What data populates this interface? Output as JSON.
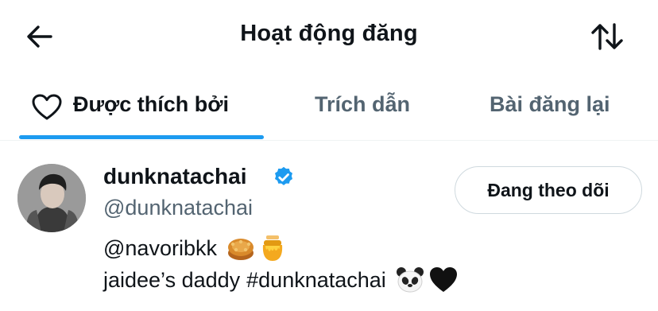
{
  "header": {
    "title": "Hoạt động đăng",
    "back_icon": "arrow-left-icon",
    "sort_icon": "sort-arrows-icon"
  },
  "tabs": [
    {
      "label": "Được thích bởi",
      "icon": "heart-outline-icon",
      "active": true
    },
    {
      "label": "Trích dẫn",
      "active": false
    },
    {
      "label": "Bài đăng lại",
      "active": false
    }
  ],
  "user": {
    "display_name": "dunknatachai",
    "verified": true,
    "handle": "@dunknatachai",
    "follow_button": "Đang theo dõi",
    "bio_line1": {
      "mention": "@navoribkk",
      "emojis": [
        "mooncake-emoji",
        "honey-pot-emoji"
      ]
    },
    "bio_line2": {
      "text": "jaidee’s daddy",
      "hashtag": "#dunknatachai",
      "emojis": [
        "panda-emoji",
        "black-heart-emoji"
      ]
    }
  },
  "colors": {
    "accent": "#1d9bf0",
    "text_primary": "#0f1419",
    "text_secondary": "#536471",
    "border": "#cfd9de"
  }
}
